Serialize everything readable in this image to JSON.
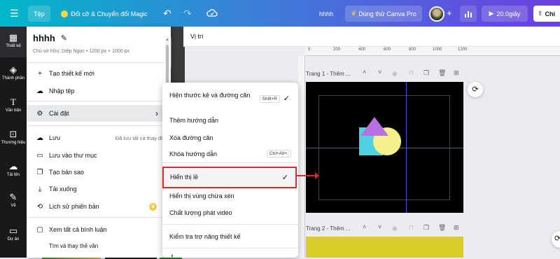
{
  "topbar": {
    "menu_icon": "hamburger-icon",
    "file_label": "Tệp",
    "magic_label": "Đổi cỡ & Chuyển đổi Magic",
    "undo_icon": "undo-icon",
    "redo_icon": "redo-icon",
    "cloud_icon": "cloud-check-icon",
    "design_name": "hhhh",
    "pro_label": "Dùng thử Canva Pro",
    "timer_label": "20.0giây",
    "share_label": "Chi"
  },
  "rail": {
    "items": [
      {
        "label": "Thiết kế",
        "icon": "layout-icon"
      },
      {
        "label": "Thành phần",
        "icon": "elements-icon"
      },
      {
        "label": "Văn bản",
        "icon": "text-icon"
      },
      {
        "label": "Thương hiệu",
        "icon": "brand-icon"
      },
      {
        "label": "Tải lên",
        "icon": "upload-icon"
      },
      {
        "label": "Vẽ",
        "icon": "draw-icon"
      },
      {
        "label": "Dự án",
        "icon": "folder-icon"
      }
    ]
  },
  "file_menu": {
    "title": "hhhh",
    "meta": "Chủ sở hữu: Diệp Ngọc • 1200 px × 1000 px",
    "items": [
      {
        "label": "Tạo thiết kế mới",
        "icon": "plus-icon"
      },
      {
        "label": "Nhập tệp",
        "icon": "cloud-upload-icon"
      },
      {
        "label": "Cài đặt",
        "icon": "gear-icon"
      },
      {
        "label": "Lưu",
        "icon": "cloud-icon",
        "note": "Đã lưu tất cả thay đổi"
      },
      {
        "label": "Lưu vào thư mục",
        "icon": "folder-icon"
      },
      {
        "label": "Tạo bản sao",
        "icon": "copy-icon"
      },
      {
        "label": "Tải xuống",
        "icon": "download-icon"
      },
      {
        "label": "Lịch sử phiên bản",
        "icon": "history-icon"
      },
      {
        "label": "Xem tất cả bình luận",
        "icon": "comment-icon"
      },
      {
        "label": "Tìm và thay thế văn",
        "icon": "search-icon"
      }
    ]
  },
  "settings_submenu": {
    "items": [
      {
        "label": "Hiện thước kẻ và đường căn",
        "shortcut": "Shift+R",
        "checked": true
      },
      {
        "label": "Thêm hướng dẫn"
      },
      {
        "label": "Xóa đường căn"
      },
      {
        "label": "Khóa hướng dẫn",
        "shortcut": "Ctrl+Alt+;"
      },
      {
        "label": "Hiển thị lề",
        "checked": true,
        "highlighted": true
      },
      {
        "label": "Hiển thị vùng chừa xén"
      },
      {
        "label": "Chất lượng phát video"
      },
      {
        "label": "Kiểm tra trợ năng thiết kế"
      }
    ]
  },
  "toolbar": {
    "position_label": "Vị trí"
  },
  "ruler": {
    "ticks": [
      "0",
      "200",
      "400",
      "600",
      "800",
      "1000",
      "1200"
    ]
  },
  "pages": [
    {
      "title": "Trang 1 - Thêm ...",
      "background": "#000000"
    },
    {
      "title": "Trang 2 - Thêm ...",
      "background": "#d9cd2a"
    }
  ],
  "colors": {
    "accent": "#8b3dff",
    "highlight_border": "#d92b2b",
    "page1_bg": "#000000",
    "page2_bg": "#d9cd2a"
  }
}
